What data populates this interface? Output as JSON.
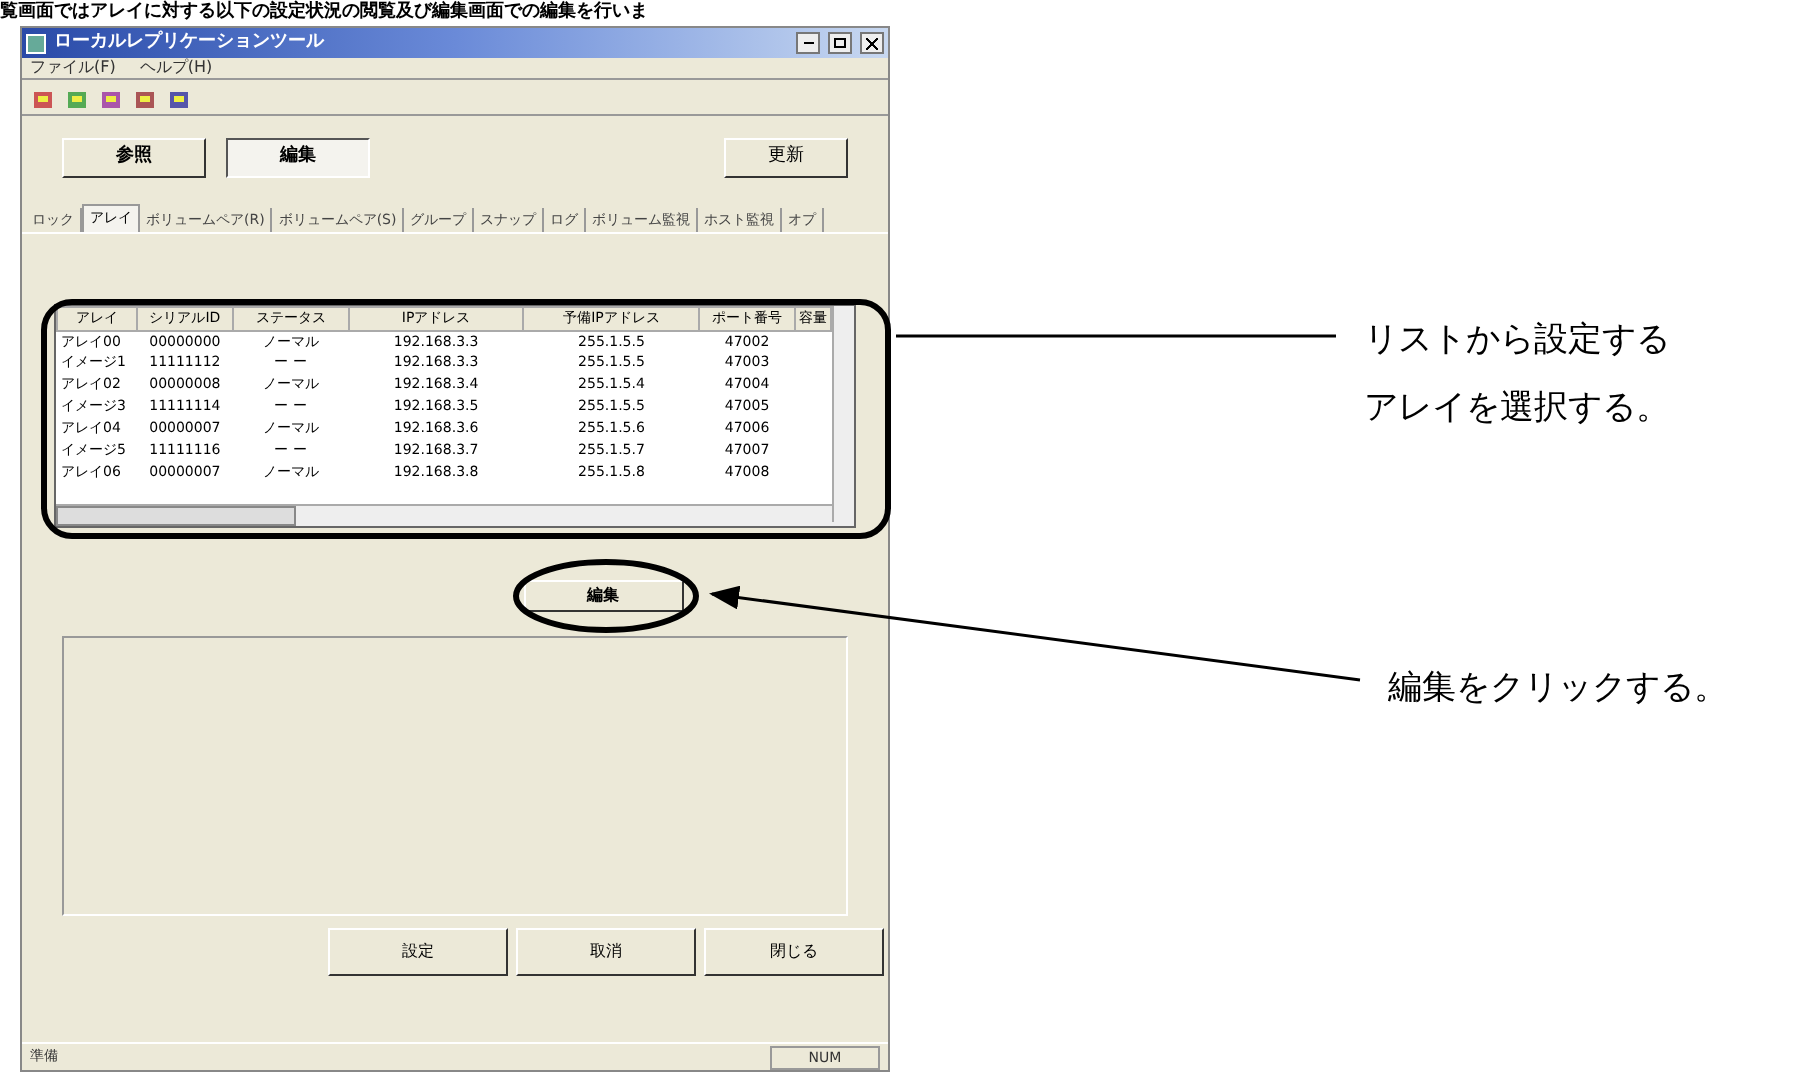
{
  "page_heading": "覧画面ではアレイに対する以下の設定状況の閲覧及び編集画面での編集を行いま",
  "window": {
    "title": "ローカルレプリケーションツール"
  },
  "menu": [
    "ファイル(F)",
    "ヘルプ(H)"
  ],
  "mode_buttons": [
    {
      "label": "参照",
      "selected": false
    },
    {
      "label": "編集",
      "selected": true
    }
  ],
  "refresh_button": "更新",
  "tabs": [
    {
      "label": "ロック",
      "selected": false
    },
    {
      "label": "アレイ",
      "selected": true
    },
    {
      "label": "ボリュームペア(R)",
      "selected": false
    },
    {
      "label": "ボリュームペア(S)",
      "selected": false
    },
    {
      "label": "グループ",
      "selected": false
    },
    {
      "label": "スナップ",
      "selected": false
    },
    {
      "label": "ログ",
      "selected": false
    },
    {
      "label": "ボリューム監視",
      "selected": false
    },
    {
      "label": "ホスト監視",
      "selected": false
    },
    {
      "label": "オプ",
      "selected": false
    }
  ],
  "table": {
    "columns": [
      "アレイ",
      "シリアルID",
      "ステータス",
      "IPアドレス",
      "予備IPアドレス",
      "ポート番号",
      "容量"
    ],
    "rows": [
      [
        "アレイ00",
        "00000000",
        "ノーマル",
        "192.168.3.3",
        "255.1.5.5",
        "47002",
        ""
      ],
      [
        "イメージ1",
        "11111112",
        "ー ー",
        "192.168.3.3",
        "255.1.5.5",
        "47003",
        ""
      ],
      [
        "アレイ02",
        "00000008",
        "ノーマル",
        "192.168.3.4",
        "255.1.5.4",
        "47004",
        ""
      ],
      [
        "イメージ3",
        "11111114",
        "ー ー",
        "192.168.3.5",
        "255.1.5.5",
        "47005",
        ""
      ],
      [
        "アレイ04",
        "00000007",
        "ノーマル",
        "192.168.3.6",
        "255.1.5.6",
        "47006",
        ""
      ],
      [
        "イメージ5",
        "11111116",
        "ー ー",
        "192.168.3.7",
        "255.1.5.7",
        "47007",
        ""
      ],
      [
        "アレイ06",
        "00000007",
        "ノーマル",
        "192.168.3.8",
        "255.1.5.8",
        "47008",
        ""
      ]
    ]
  },
  "edit_button": "編集",
  "bottom_buttons": [
    "設定",
    "取消",
    "閉じる"
  ],
  "status_bar": {
    "left": "準備",
    "right": "NUM"
  },
  "annotations": [
    {
      "lines": [
        "リストから設定する",
        "アレイを選択する。"
      ]
    },
    {
      "lines": [
        "編集をクリックする。"
      ]
    }
  ]
}
